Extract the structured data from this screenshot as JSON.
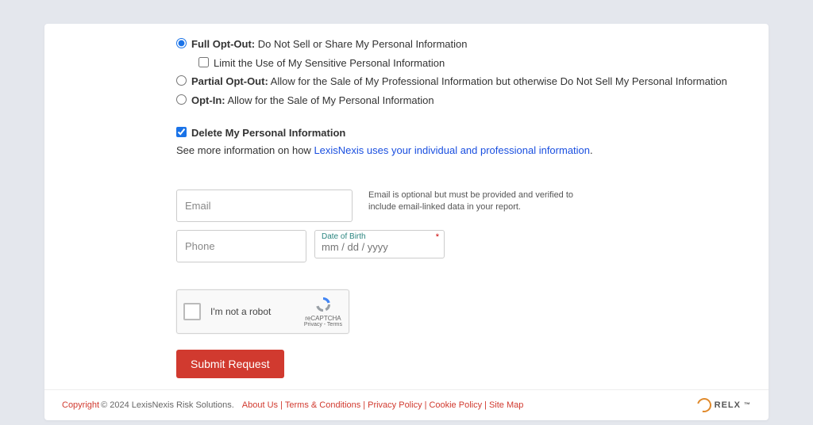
{
  "options": {
    "full_opt_out": {
      "title": "Full Opt-Out:",
      "desc": " Do Not Sell or Share My Personal Information"
    },
    "limit_sensitive": "Limit the Use of My Sensitive Personal Information",
    "partial_opt_out": {
      "title": "Partial Opt-Out:",
      "desc": " Allow for the Sale of My Professional Information but otherwise Do Not Sell My Personal Information"
    },
    "opt_in": {
      "title": "Opt-In:",
      "desc": " Allow for the Sale of My Personal Information"
    },
    "delete_info": "Delete My Personal Information"
  },
  "info": {
    "prefix": "See more information on how ",
    "link_text": "LexisNexis uses your individual and professional information"
  },
  "form": {
    "email_placeholder": "Email",
    "email_helper": "Email is optional but must be provided and verified to include email-linked data in your report.",
    "phone_placeholder": "Phone",
    "dob_label": "Date of Birth",
    "dob_placeholder": "mm / dd / yyyy"
  },
  "captcha": {
    "text": "I'm not a robot",
    "brand": "reCAPTCHA",
    "sub": "Privacy - Terms"
  },
  "submit_label": "Submit Request",
  "footer": {
    "copyright_label": "Copyright",
    "copyright_rest": " © 2024 LexisNexis Risk Solutions.",
    "links": {
      "about": "About Us",
      "terms": "Terms & Conditions",
      "privacy": "Privacy Policy",
      "cookie": "Cookie Policy",
      "sitemap": "Site Map"
    },
    "brand": "RELX",
    "tm": "™"
  }
}
